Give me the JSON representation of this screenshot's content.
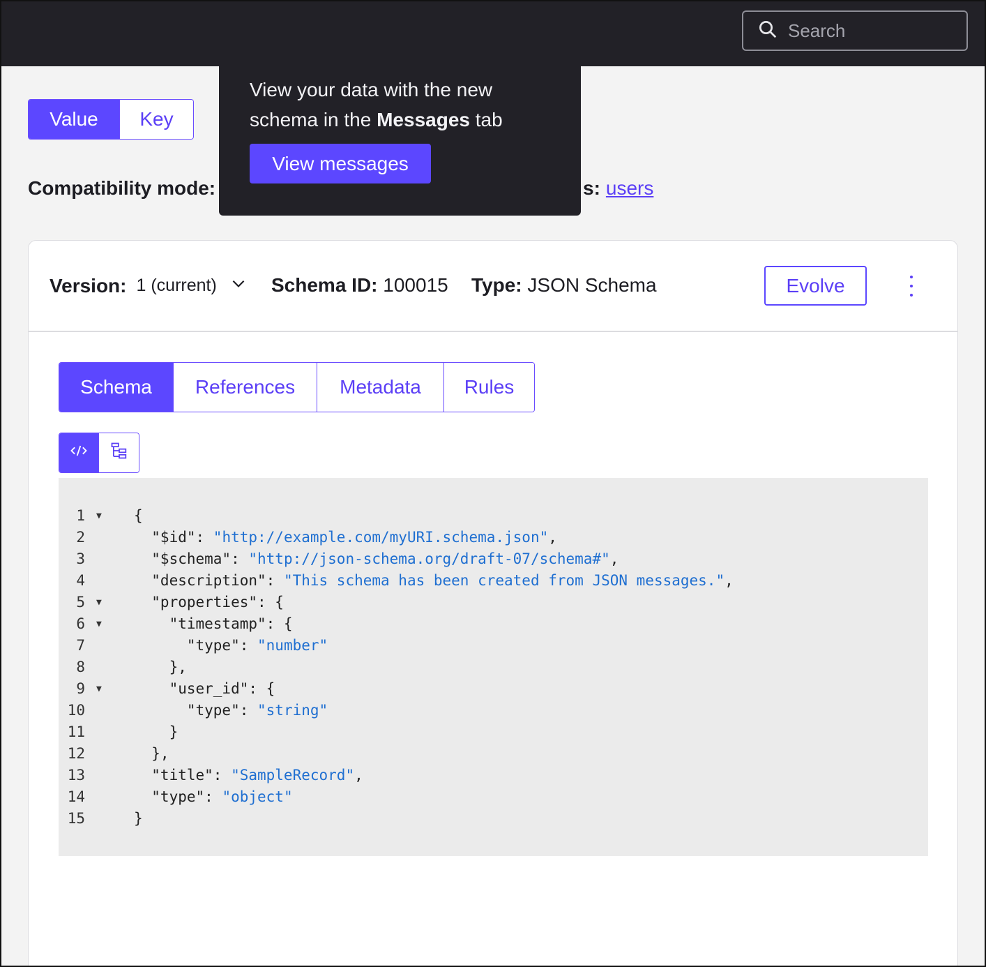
{
  "search": {
    "placeholder": "Search"
  },
  "format_toggle": {
    "value_label": "Value",
    "key_label": "Key",
    "selected": "Value"
  },
  "info_row": {
    "compat_label": "Compatibility mode:",
    "subjects_label_partial": "s:",
    "subjects_link": "users"
  },
  "popover": {
    "message_line1": "View your data with the new",
    "message_line2_prefix": "schema in the ",
    "message_line2_bold": "Messages",
    "message_line2_suffix": " tab",
    "button_label": "View messages"
  },
  "schema_card": {
    "version_label": "Version:",
    "version_value": "1 (current)",
    "schema_id_label": "Schema ID:",
    "schema_id_value": "100015",
    "type_label": "Type:",
    "type_value": "JSON Schema",
    "evolve_label": "Evolve"
  },
  "tabs": [
    {
      "label": "Schema",
      "active": true
    },
    {
      "label": "References",
      "active": false
    },
    {
      "label": "Metadata",
      "active": false
    },
    {
      "label": "Rules",
      "active": false
    }
  ],
  "view_modes": {
    "selected": "code",
    "icons": [
      "code-icon",
      "tree-icon"
    ]
  },
  "code_lines": [
    {
      "n": "1",
      "fold": true,
      "text": "{"
    },
    {
      "n": "2",
      "fold": false,
      "text": "  \"$id\": ",
      "str": "\"http://example.com/myURI.schema.json\"",
      "after": ","
    },
    {
      "n": "3",
      "fold": false,
      "text": "  \"$schema\": ",
      "str": "\"http://json-schema.org/draft-07/schema#\"",
      "after": ","
    },
    {
      "n": "4",
      "fold": false,
      "text": "  \"description\": ",
      "str": "\"This schema has been created from JSON messages.\"",
      "after": ","
    },
    {
      "n": "5",
      "fold": true,
      "text": "  \"properties\": {"
    },
    {
      "n": "6",
      "fold": true,
      "text": "    \"timestamp\": {"
    },
    {
      "n": "7",
      "fold": false,
      "text": "      \"type\": ",
      "str": "\"number\"",
      "after": ""
    },
    {
      "n": "8",
      "fold": false,
      "text": "    },"
    },
    {
      "n": "9",
      "fold": true,
      "text": "    \"user_id\": {"
    },
    {
      "n": "10",
      "fold": false,
      "text": "      \"type\": ",
      "str": "\"string\"",
      "after": ""
    },
    {
      "n": "11",
      "fold": false,
      "text": "    }"
    },
    {
      "n": "12",
      "fold": false,
      "text": "  },"
    },
    {
      "n": "13",
      "fold": false,
      "text": "  \"title\": ",
      "str": "\"SampleRecord\"",
      "after": ","
    },
    {
      "n": "14",
      "fold": false,
      "text": "  \"type\": ",
      "str": "\"object\"",
      "after": ""
    },
    {
      "n": "15",
      "fold": false,
      "text": "}"
    }
  ],
  "colors": {
    "accent": "#5c47ff",
    "topbar": "#222127",
    "code_string": "#1f6fd1",
    "page_bg": "#f3f3f3"
  }
}
